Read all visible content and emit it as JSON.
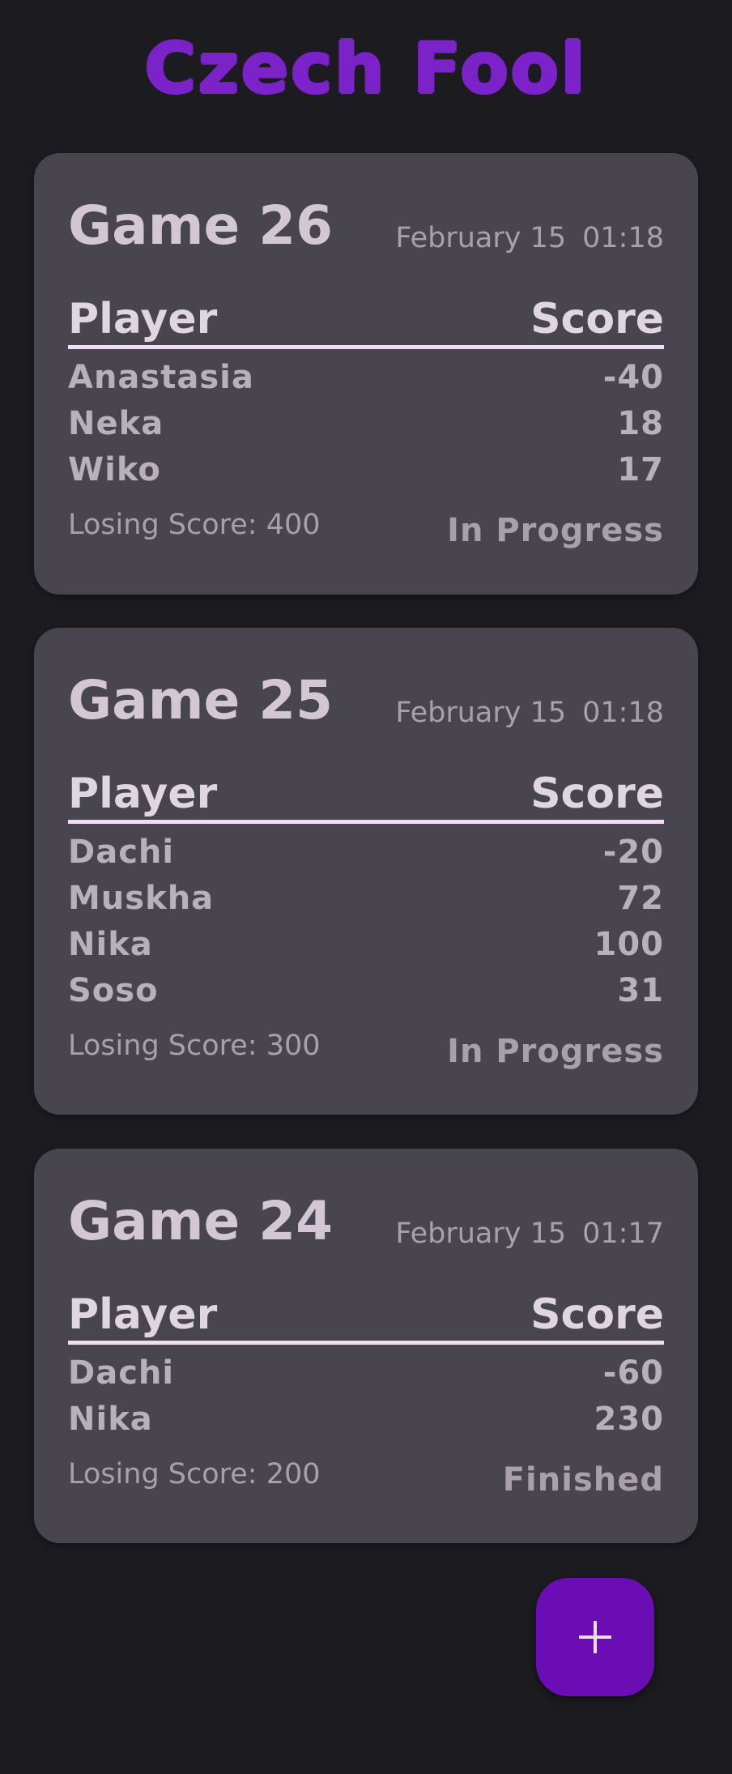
{
  "app": {
    "title": "Czech Fool"
  },
  "table_headers": {
    "player": "Player",
    "score": "Score"
  },
  "games": [
    {
      "title": "Game 26",
      "date": "February 15",
      "time": "01:18",
      "players": [
        {
          "name": "Anastasia",
          "score": "-40"
        },
        {
          "name": "Neka",
          "score": "18"
        },
        {
          "name": "Wiko",
          "score": "17"
        }
      ],
      "losing_score": "Losing Score: 400",
      "status": "In Progress"
    },
    {
      "title": "Game 25",
      "date": "February 15",
      "time": "01:18",
      "players": [
        {
          "name": "Dachi",
          "score": "-20"
        },
        {
          "name": "Muskha",
          "score": "72"
        },
        {
          "name": "Nika",
          "score": "100"
        },
        {
          "name": "Soso",
          "score": "31"
        }
      ],
      "losing_score": "Losing Score: 300",
      "status": "In Progress"
    },
    {
      "title": "Game 24",
      "date": "February 15",
      "time": "01:17",
      "players": [
        {
          "name": "Dachi",
          "score": "-60"
        },
        {
          "name": "Nika",
          "score": "230"
        }
      ],
      "losing_score": "Losing Score: 200",
      "status": "Finished"
    }
  ],
  "fab": {
    "icon": "plus-icon"
  },
  "colors": {
    "background": "#1c1b1f",
    "card": "#49454f",
    "accent": "#7b22c9",
    "fab": "#6a0db5",
    "divider": "#f1ddf6"
  }
}
